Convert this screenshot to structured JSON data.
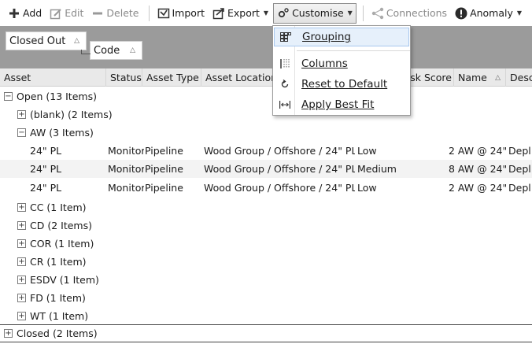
{
  "toolbar": {
    "add": "Add",
    "edit": "Edit",
    "delete": "Delete",
    "import": "Import",
    "export": "Export",
    "customise": "Customise",
    "connections": "Connections",
    "anomaly": "Anomaly"
  },
  "group_panel": {
    "chip1": "Closed Out",
    "chip2": "Code"
  },
  "columns": {
    "asset": "Asset",
    "status": "Status",
    "asset_type": "Asset Type",
    "asset_location": "Asset Location",
    "risk_score": "Risk Score",
    "name": "Name",
    "desc": "Desc"
  },
  "groups": {
    "open": "Open (13 Items)",
    "blank": "(blank) (2 Items)",
    "aw": "AW (3 Items)",
    "cc": "CC (1 Item)",
    "cd": "CD (2 Items)",
    "cor": "COR (1 Item)",
    "cr": "CR (1 Item)",
    "esdv": "ESDV (1 Item)",
    "fd": "FD (1 Item)",
    "wt": "WT (1 Item)",
    "closed": "Closed (2 Items)"
  },
  "rows": [
    {
      "asset": "24\" PL",
      "status": "Monitor",
      "type": "Pipeline",
      "location": "Wood Group / Offshore / 24\" PL",
      "risk": "Low",
      "name": "2 AW @ 24\"",
      "desc": "Depl"
    },
    {
      "asset": "24\" PL",
      "status": "Monitor",
      "type": "Pipeline",
      "location": "Wood Group / Offshore / 24\" PL",
      "risk": "Medium",
      "name": "8 AW @ 24\"",
      "desc": "Depl"
    },
    {
      "asset": "24\" PL",
      "status": "Monitor",
      "type": "Pipeline",
      "location": "Wood Group / Offshore / 24\" PL",
      "risk": "Low",
      "name": "2 AW @ 24\"",
      "desc": "Depl"
    }
  ],
  "menu": {
    "grouping": "Grouping",
    "columns": "Columns",
    "reset": "Reset to Default",
    "best_fit": "Apply Best Fit"
  }
}
